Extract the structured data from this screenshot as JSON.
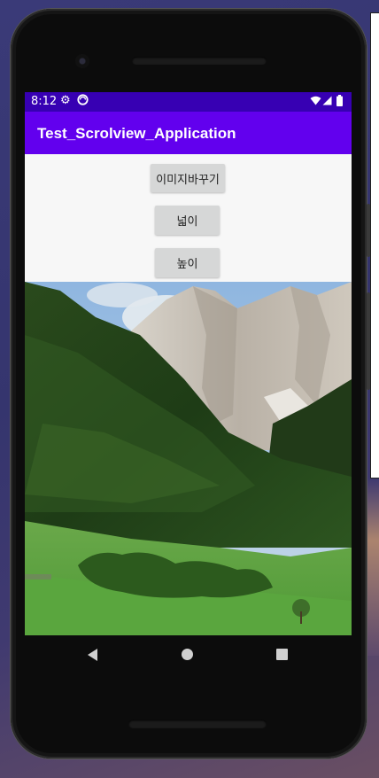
{
  "status_bar": {
    "time": "8:12",
    "left_icons": [
      "gear-icon",
      "sync-icon"
    ],
    "right_icons": [
      "wifi-icon",
      "signal-icon",
      "battery-icon"
    ]
  },
  "app_bar": {
    "title": "Test_Scrolview_Application",
    "color": "#6200ee"
  },
  "buttons": {
    "change_image": "이미지바꾸기",
    "width": "넓이",
    "height": "높이"
  },
  "image": {
    "description_icon": "landscape-image"
  },
  "navigation": {
    "icons": [
      "back-icon",
      "home-icon",
      "recents-icon"
    ]
  },
  "colors": {
    "status_bar": "#3700b3",
    "app_bar": "#6200ee",
    "button_bg": "#d6d7d7"
  }
}
